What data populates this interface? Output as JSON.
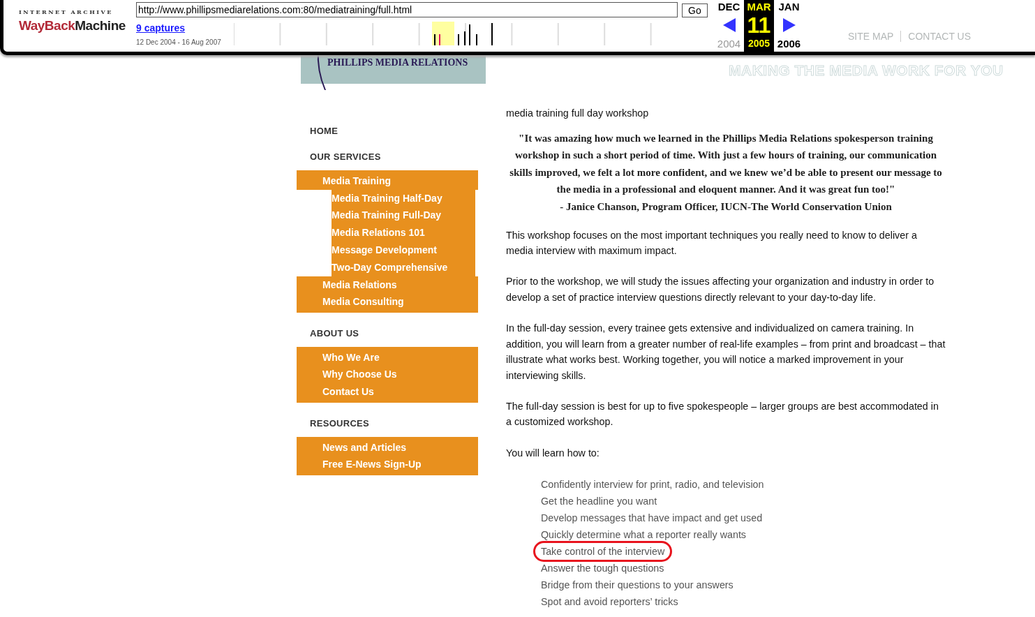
{
  "toolbar": {
    "logo_top": "INTERNET ARCHIVE",
    "logo_wayback": "WayBack",
    "logo_machine": "Machine",
    "url": "http://www.phillipsmediarelations.com:80/mediatraining/full.html",
    "go": "Go",
    "captures": "9 captures",
    "date_range": "12 Dec 2004 - 16 Aug 2007",
    "months": [
      {
        "label": "DEC",
        "selected": false
      },
      {
        "label": "MAR",
        "selected": true
      },
      {
        "label": "JAN",
        "selected": false
      }
    ],
    "day": "11",
    "years": [
      {
        "label": "2004",
        "selected": false,
        "disabled": true
      },
      {
        "label": "2005",
        "selected": true,
        "disabled": false
      },
      {
        "label": "2006",
        "selected": false,
        "disabled": false
      }
    ]
  },
  "header": {
    "links": [
      "SITE MAP",
      "CONTACT US"
    ],
    "tagline": "MAKING THE MEDIA WORK FOR YOU",
    "logo_text": "PHILLIPS MEDIA RELATIONS"
  },
  "nav": [
    {
      "heading": "HOME"
    },
    {
      "heading": "OUR SERVICES",
      "items": [
        {
          "label": "Media Training",
          "children": [
            {
              "label": "Media Training Half-Day"
            },
            {
              "label": "Media Training Full-Day"
            },
            {
              "label": "Media Relations 101"
            },
            {
              "label": "Message Development"
            },
            {
              "label": "Two-Day Comprehensive"
            }
          ]
        },
        {
          "label": "Media Relations"
        },
        {
          "label": "Media Consulting"
        }
      ]
    },
    {
      "heading": "ABOUT US",
      "items": [
        {
          "label": "Who We Are"
        },
        {
          "label": "Why Choose Us"
        },
        {
          "label": "Contact Us"
        }
      ]
    },
    {
      "heading": "RESOURCES",
      "items": [
        {
          "label": "News and Articles"
        },
        {
          "label": "Free E-News Sign-Up"
        }
      ]
    }
  ],
  "content": {
    "title": "media training full day workshop",
    "quote": "\"It was amazing how much we learned in the Phillips Media Relations spokesperson training workshop in such a short period of time. With just a few hours of training, our communication skills improved, we felt a lot more confident, and we knew we’d be able to present our message to the media in a professional and eloquent manner. And it was great fun too!\"",
    "attribution": "- Janice Chanson, Program Officer, IUCN-The World Conservation Union",
    "paragraphs": [
      "This workshop focuses on the most important techniques you really need to know to deliver a media interview with maximum impact.",
      "Prior to the workshop, we will study the issues affecting your organization and industry in order to develop a set of practice interview questions directly relevant to your day-to-day life.",
      "In the full-day session, every trainee gets extensive and individualized on camera training. In addition, you will learn from a greater number of real-life examples – from print and broadcast – that illustrate what works best. Working together, you will notice a marked improvement in your interviewing skills.",
      "The full-day session is best for up to five spokespeople – larger groups are best accommodated in a customized workshop.",
      "You will learn how to:"
    ],
    "learn_list": [
      {
        "text": "Confidently interview for print, radio, and television",
        "circled": false
      },
      {
        "text": "Get the headline you want",
        "circled": false
      },
      {
        "text": "Develop messages that have impact and get used",
        "circled": false
      },
      {
        "text": "Quickly determine what a reporter really wants",
        "circled": false
      },
      {
        "text": "Take control of the interview",
        "circled": true
      },
      {
        "text": "Answer the tough questions",
        "circled": false
      },
      {
        "text": "Bridge from their questions to your answers",
        "circled": false
      },
      {
        "text": "Spot and avoid reporters’ tricks",
        "circled": false
      }
    ]
  }
}
